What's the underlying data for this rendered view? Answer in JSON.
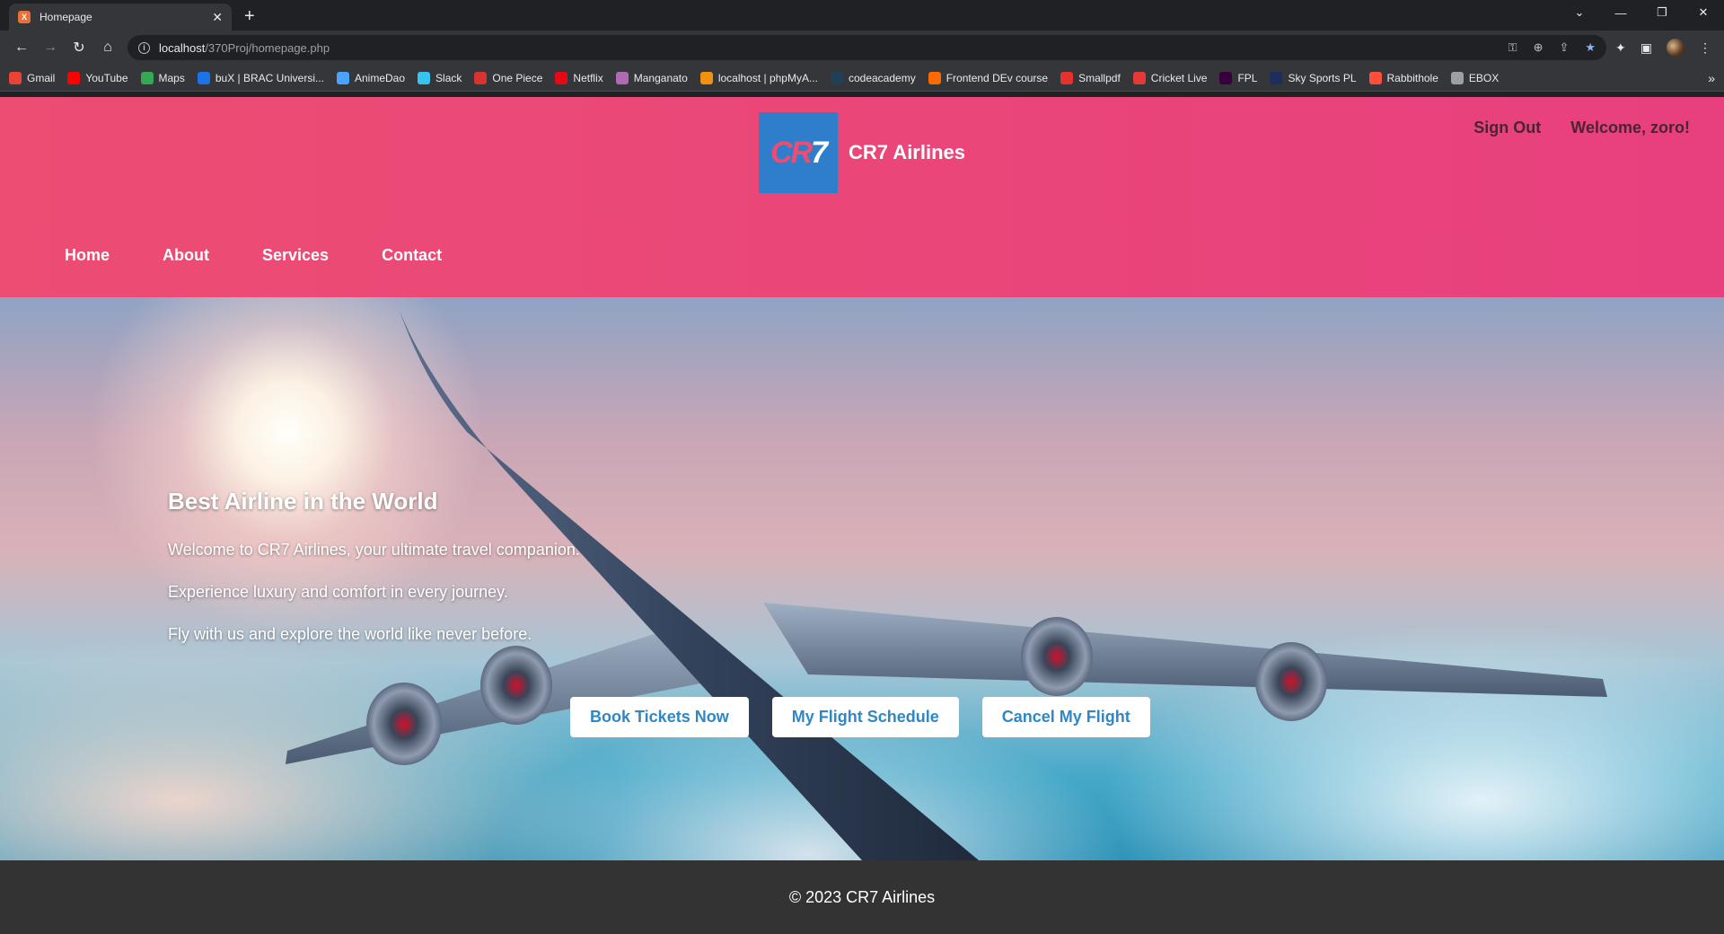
{
  "browser": {
    "tab_title": "Homepage",
    "tab_favicon": "X",
    "url_host": "localhost",
    "url_path": "/370Proj/homepage.php",
    "bookmarks": [
      {
        "label": "Gmail",
        "color": "#ea4335"
      },
      {
        "label": "YouTube",
        "color": "#ff0000"
      },
      {
        "label": "Maps",
        "color": "#34a853"
      },
      {
        "label": "buX | BRAC Universi...",
        "color": "#1a73e8"
      },
      {
        "label": "AnimeDao",
        "color": "#4aa3ff"
      },
      {
        "label": "Slack",
        "color": "#36c5f0"
      },
      {
        "label": "One Piece",
        "color": "#d63333"
      },
      {
        "label": "Netflix",
        "color": "#e50914"
      },
      {
        "label": "Manganato",
        "color": "#b06ab3"
      },
      {
        "label": "localhost | phpMyA...",
        "color": "#f29111"
      },
      {
        "label": "codeacademy",
        "color": "#1f4056"
      },
      {
        "label": "Frontend DEv course",
        "color": "#ff6a00"
      },
      {
        "label": "Smallpdf",
        "color": "#e5322d"
      },
      {
        "label": "Cricket Live",
        "color": "#e53935"
      },
      {
        "label": "FPL",
        "color": "#37003c"
      },
      {
        "label": "Sky Sports PL",
        "color": "#1d2d5c"
      },
      {
        "label": "Rabbithole",
        "color": "#ff4f3a"
      },
      {
        "label": "EBOX",
        "color": "#9aa0a6"
      }
    ]
  },
  "header": {
    "logo_text_left": "CR",
    "logo_text_right": "7",
    "brand": "CR7 Airlines",
    "sign_out": "Sign Out",
    "welcome": "Welcome, zoro!"
  },
  "nav": {
    "home": "Home",
    "about": "About",
    "services": "Services",
    "contact": "Contact"
  },
  "hero": {
    "title": "Best Airline in the World",
    "line1": "Welcome to CR7 Airlines, your ultimate travel companion.",
    "line2": "Experience luxury and comfort in every journey.",
    "line3": "Fly with us and explore the world like never before.",
    "btn_book": "Book Tickets Now",
    "btn_schedule": "My Flight Schedule",
    "btn_cancel": "Cancel My Flight"
  },
  "footer": {
    "copyright": "© 2023 CR7 Airlines"
  },
  "colors": {
    "header_start": "#ec4d73",
    "header_end": "#e8407e",
    "logo_bg": "#2f7ecb",
    "button_text": "#2f87c5",
    "footer_bg": "#333333"
  }
}
